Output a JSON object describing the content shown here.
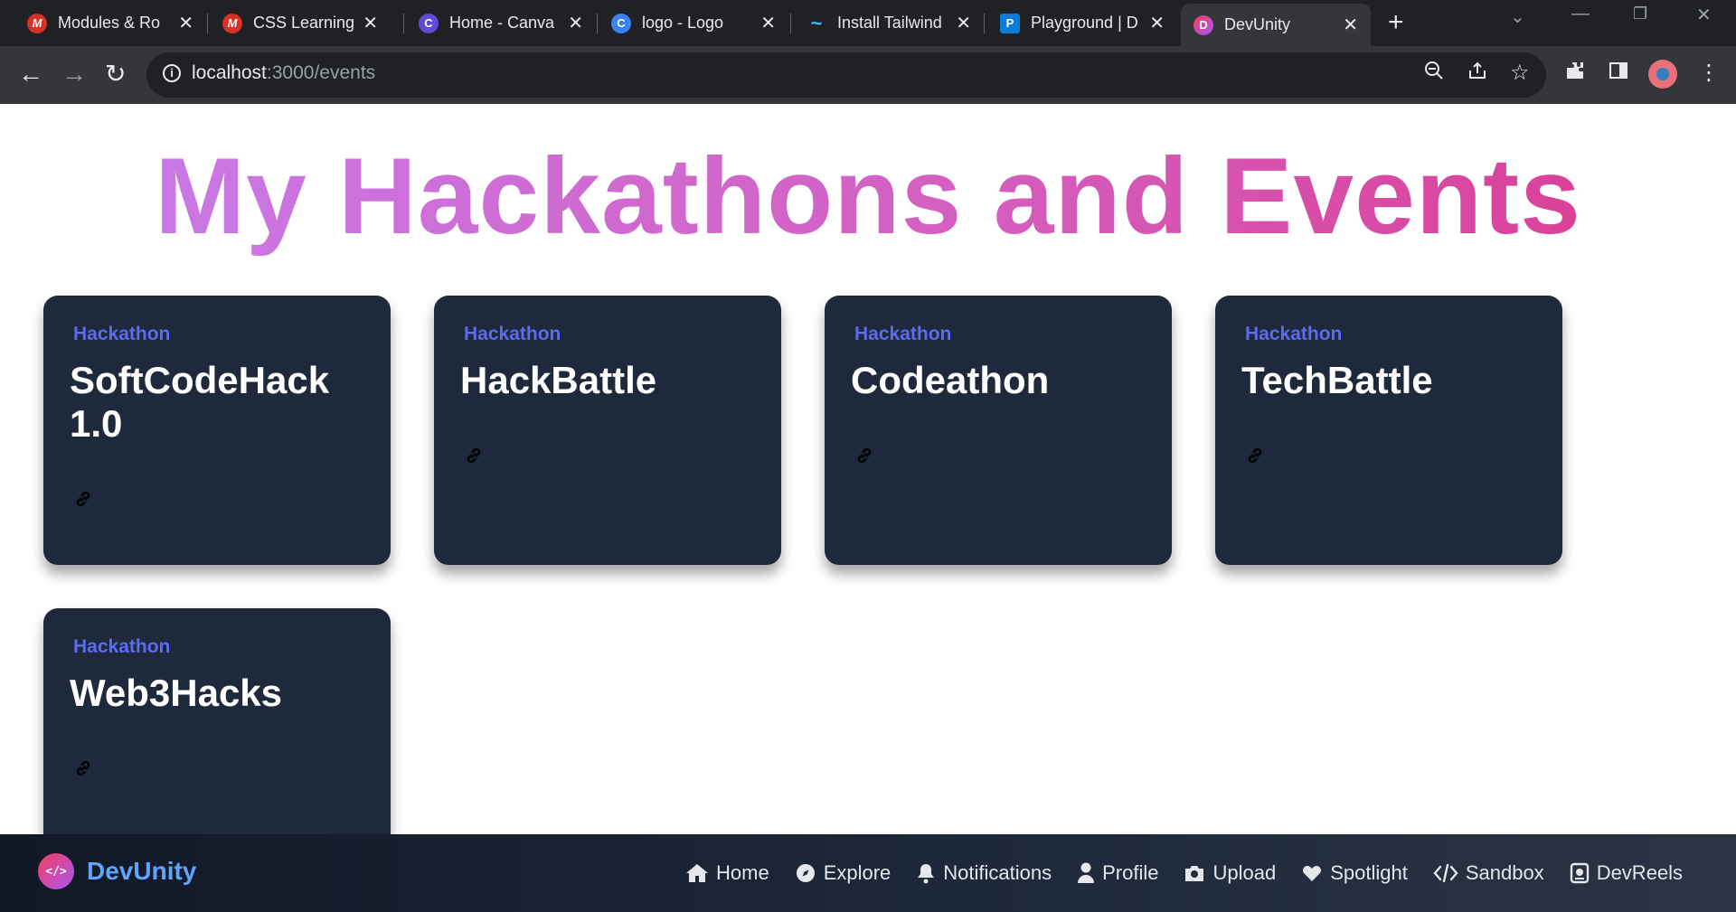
{
  "browser": {
    "tabs": [
      {
        "title": "Modules & Ro",
        "favicon": "M",
        "favicon_color": "#d93025",
        "active": false
      },
      {
        "title": "CSS Learning P",
        "favicon": "M",
        "favicon_color": "#d93025",
        "active": false
      },
      {
        "title": "Home - Canva",
        "favicon": "C",
        "favicon_color": "#5f4bd8",
        "active": false
      },
      {
        "title": "logo - Logo",
        "favicon": "C",
        "favicon_color": "#3b82f6",
        "active": false
      },
      {
        "title": "Install Tailwind",
        "favicon": "~",
        "favicon_color": "#38bdf8",
        "active": false
      },
      {
        "title": "Playground | D",
        "favicon": "P",
        "favicon_color": "#0b7dd6",
        "active": false
      },
      {
        "title": "DevUnity",
        "favicon": "D",
        "favicon_color": "#a855f7",
        "active": true
      }
    ],
    "url": {
      "host": "localhost",
      "path": ":3000/events"
    }
  },
  "page": {
    "title": "My Hackathons and Events",
    "events": [
      {
        "tag": "Hackathon",
        "name": "SoftCodeHack 1.0"
      },
      {
        "tag": "Hackathon",
        "name": "HackBattle"
      },
      {
        "tag": "Hackathon",
        "name": "Codeathon"
      },
      {
        "tag": "Hackathon",
        "name": "TechBattle"
      },
      {
        "tag": "Hackathon",
        "name": "Web3Hacks"
      }
    ]
  },
  "bottom_nav": {
    "brand": "DevUnity",
    "brand_logo_text": "</>",
    "links": [
      {
        "label": "Home",
        "icon": "home-icon"
      },
      {
        "label": "Explore",
        "icon": "compass-icon"
      },
      {
        "label": "Notifications",
        "icon": "bell-icon"
      },
      {
        "label": "Profile",
        "icon": "user-icon"
      },
      {
        "label": "Upload",
        "icon": "camera-icon"
      },
      {
        "label": "Spotlight",
        "icon": "heart-icon"
      },
      {
        "label": "Sandbox",
        "icon": "code-icon"
      },
      {
        "label": "DevReels",
        "icon": "reels-icon"
      }
    ]
  },
  "colors": {
    "card_bg": "#1e293b",
    "tag": "#5b6cf0",
    "brand": "#60a5fa",
    "title_gradient": [
      "#c77ded",
      "#db3a8f"
    ]
  }
}
